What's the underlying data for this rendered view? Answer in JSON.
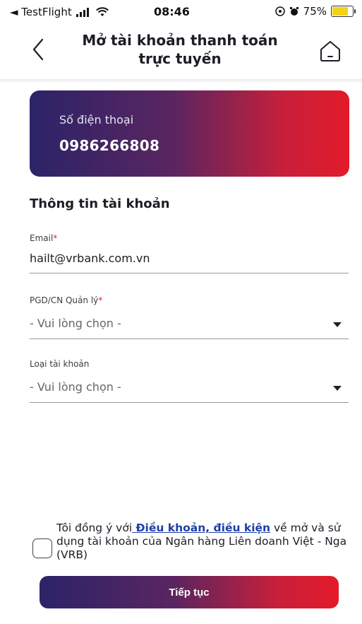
{
  "status_bar": {
    "back_app": "◄ TestFlight",
    "time": "08:46",
    "battery": "75%",
    "battery_color": "#f4d21a"
  },
  "nav": {
    "title_line1": "Mở tài khoản thanh toán",
    "title_line2": "trực tuyến",
    "back_icon": "chevron-left-icon",
    "home_icon": "home-icon"
  },
  "phone_card": {
    "label": "Số điện thoại",
    "value": "0986266808",
    "gradient": [
      "#2b2468",
      "#e31b2a"
    ]
  },
  "account_info": {
    "title": "Thông tin tài khoản",
    "email": {
      "label": "Email",
      "required": "*",
      "value": "hailt@vrbank.com.vn"
    },
    "branch": {
      "label": "PGD/CN Quản lý",
      "required": "*",
      "placeholder": "- Vui lòng chọn -"
    },
    "account_type": {
      "label": "Loại tài khoản",
      "placeholder": "- Vui lòng chọn -"
    }
  },
  "agreement": {
    "prefix": "Tôi đồng ý với",
    "link": " Điều khoản, điều kiện",
    "suffix": " về mở và sử dụng tài khoản của Ngân hàng Liên doanh Việt - Nga (VRB)",
    "checked": false
  },
  "cta": {
    "label": "Tiếp tục"
  }
}
